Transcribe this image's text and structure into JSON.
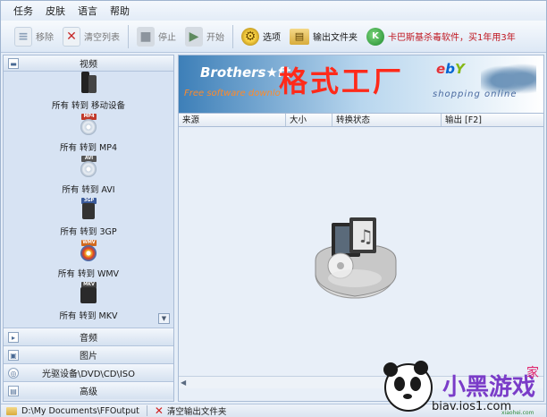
{
  "menu": [
    "任务",
    "皮肤",
    "语言",
    "帮助"
  ],
  "toolbar": {
    "remove": "移除",
    "clear_list": "清空列表",
    "stop": "停止",
    "start": "开始",
    "options": "选项",
    "output_folder": "输出文件夹",
    "ad": "卡巴斯基杀毒软件，买1年用3年"
  },
  "left_panel": {
    "video_header": "视频",
    "items": [
      {
        "label": "所有 转到 移动设备",
        "tag": "",
        "icon": "mobile-device-icon"
      },
      {
        "label": "所有 转到 MP4",
        "tag": "MP4",
        "icon": "mp4-icon"
      },
      {
        "label": "所有 转到 AVI",
        "tag": "AVI",
        "icon": "avi-icon"
      },
      {
        "label": "所有 转到 3GP",
        "tag": "3GP",
        "icon": "3gp-icon"
      },
      {
        "label": "所有 转到 WMV",
        "tag": "WMV",
        "icon": "wmv-icon"
      },
      {
        "label": "所有 转到 MKV",
        "tag": "MKV",
        "icon": "mkv-icon"
      }
    ],
    "categories": [
      "音频",
      "图片",
      "光驱设备\\DVD\\CD\\ISO",
      "高级"
    ]
  },
  "banner": {
    "brothers": "Brothers★ft",
    "tagline": "Free software downlo",
    "title": "格式工厂",
    "ebay_e": "e",
    "ebay_b": "b",
    "ebay_y": "Y",
    "shopping": "shopping online"
  },
  "table": {
    "columns": [
      "来源",
      "大小",
      "转换状态",
      "输出 [F2]"
    ]
  },
  "statusbar": {
    "path": "D:\\My Documents\\FFOutput",
    "clear_output": "清空输出文件夹"
  },
  "watermark": {
    "site": "biav.ios1.com",
    "brand": "小黑游戏",
    "home": "家",
    "domain": "xiaohei.com"
  },
  "colors": {
    "accent_red": "#ff2a1a",
    "panel_bg": "#dfe8f4",
    "tag_mp4": "#c0392b",
    "tag_avi": "#555555",
    "tag_3gp": "#3a5a9a",
    "tag_wmv": "#d2691e",
    "tag_mkv": "#444444"
  }
}
